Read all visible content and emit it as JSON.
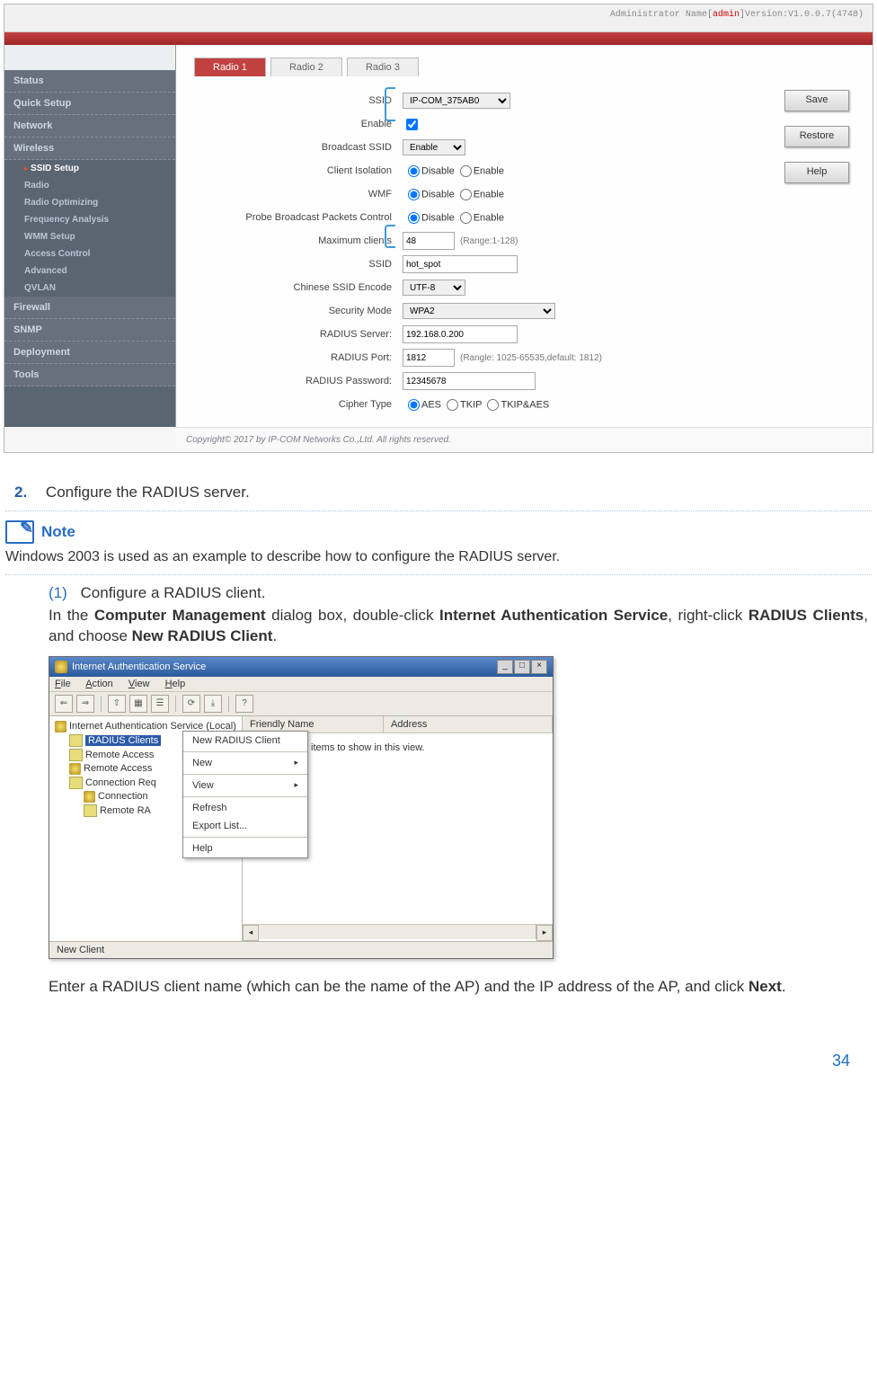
{
  "router": {
    "adminPrefix": "Administrator Name[",
    "adminName": "admin",
    "adminSuffix": "]Version:V1.0.0.7(4748)",
    "sidebar": {
      "items": [
        "Status",
        "Quick Setup",
        "Network",
        "Wireless",
        "Firewall",
        "SNMP",
        "Deployment",
        "Tools"
      ],
      "wirelessSub": [
        "SSID Setup",
        "Radio",
        "Radio Optimizing",
        "Frequency Analysis",
        "WMM Setup",
        "Access Control",
        "Advanced",
        "QVLAN"
      ]
    },
    "tabs": [
      "Radio 1",
      "Radio 2",
      "Radio 3"
    ],
    "fields": {
      "ssidDropLabel": "SSID",
      "ssidDrop": "IP-COM_375AB0",
      "enableLabel": "Enable",
      "broadcastLabel": "Broadcast SSID",
      "broadcastSel": "Enable",
      "isolationLabel": "Client Isolation",
      "wmfLabel": "WMF",
      "probeLabel": "Probe Broadcast Packets Control",
      "maxLabel": "Maximum clients",
      "maxVal": "48",
      "maxHint": "(Range:1-128)",
      "ssid2Label": "SSID",
      "ssid2Val": "hot_spot",
      "encLabel": "Chinese SSID Encode",
      "encSel": "UTF-8",
      "secLabel": "Security Mode",
      "secSel": "WPA2",
      "radServerLabel": "RADIUS Server:",
      "radServerVal": "192.168.0.200",
      "radPortLabel": "RADIUS Port:",
      "radPortVal": "1812",
      "radPortHint": "(Rangle: 1025-65535,default: 1812)",
      "radPassLabel": "RADIUS Password:",
      "radPassVal": "12345678",
      "cipherLabel": "Cipher Type",
      "radioDisable": "Disable",
      "radioEnable": "Enable",
      "cipherAes": "AES",
      "cipherTkip": "TKIP",
      "cipherBoth": "TKIP&AES"
    },
    "buttons": {
      "save": "Save",
      "restore": "Restore",
      "help": "Help"
    },
    "copyright": "Copyright© 2017 by IP-COM Networks Co.,Ltd. All rights reserved."
  },
  "step2Num": "2.",
  "step2Text": "Configure the RADIUS server.",
  "noteLabel": "Note",
  "noteBody": "Windows 2003 is used as an example to describe how to configure the RADIUS server.",
  "sub1Num": "(1)",
  "sub1Text": "Configure a RADIUS client.",
  "para1a": "In the ",
  "para1b": "Computer Management",
  "para1c": " dialog box, double-click ",
  "para1d": "Internet Authentication Service",
  "para1e": ", right-click ",
  "para1f": "RADIUS Clients",
  "para1g": ", and choose ",
  "para1h": "New RADIUS Client",
  "para1i": ".",
  "win": {
    "title": "Internet Authentication Service",
    "menu": [
      "File",
      "Action",
      "View",
      "Help"
    ],
    "treeRoot": "Internet Authentication Service (Local)",
    "tree": [
      "RADIUS Clients",
      "Remote Access",
      "Remote Access",
      "Connection Req",
      "Connection",
      "Remote RA"
    ],
    "colFriendly": "Friendly Name",
    "colAddress": "Address",
    "emptyMsg": "There are no items to show in this view.",
    "ctx": [
      "New RADIUS Client",
      "New",
      "View",
      "Refresh",
      "Export List...",
      "Help"
    ],
    "status": "New Client"
  },
  "para2a": "Enter a RADIUS client name (which can be the name of the AP) and the IP address of the AP, and click ",
  "para2b": "Next",
  "para2c": ".",
  "pageNumber": "34"
}
